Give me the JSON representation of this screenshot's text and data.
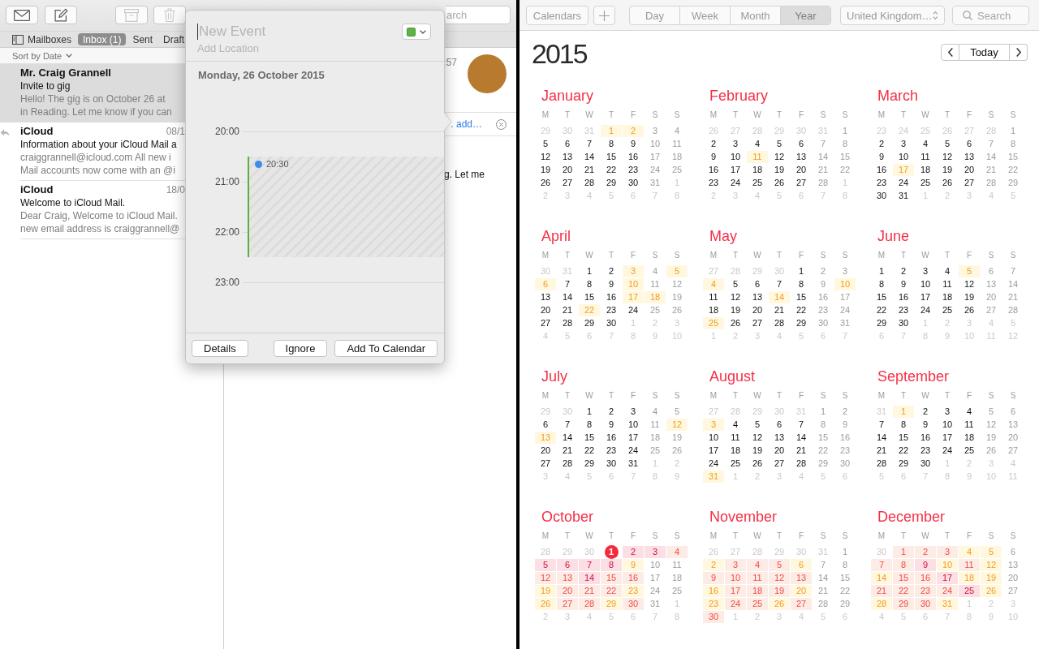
{
  "mail": {
    "toolbar": [
      {
        "kind": "get_mail",
        "disabled": false
      },
      {
        "kind": "compose",
        "disabled": false
      },
      {
        "kind": "archive",
        "disabled": true
      },
      {
        "kind": "trash",
        "disabled": true
      }
    ],
    "search": {
      "placeholder": "arch"
    },
    "favorites": [
      {
        "kind": "mailboxes",
        "label": "Mailboxes",
        "selected": false
      },
      {
        "kind": "mailbox",
        "label": "Inbox (1)",
        "selected": true
      },
      {
        "kind": "mailbox",
        "label": "Sent",
        "selected": false
      },
      {
        "kind": "mailbox",
        "label": "Draft",
        "selected": false
      }
    ],
    "sort": "Sort by Date",
    "messages": [
      {
        "sender": "Mr. Craig Grannell",
        "subject": "Invite to gig",
        "preview": [
          "Hello! The gig is on October 26 at",
          "in Reading. Let me know if you can"
        ],
        "selected": true,
        "replied": false
      },
      {
        "sender": "iCloud",
        "date": "08/1",
        "subject": "Information about your iCloud Mail a",
        "preview": [
          "craiggrannell@icloud.com All new i",
          "Mail accounts now come with an @i"
        ],
        "selected": false,
        "replied": true
      },
      {
        "sender": "iCloud",
        "date": "18/0",
        "subject": "Welcome to iCloud Mail.",
        "preview": [
          "Dear Craig, Welcome to iCloud Mail.",
          "new email address is craiggrannell@"
        ],
        "selected": false,
        "replied": false
      }
    ],
    "viewer": {
      "time": ":57",
      "banner_link": ". add…",
      "body": "g. Let me"
    }
  },
  "event_popover": {
    "title": {
      "placeholder": "New Event"
    },
    "location": {
      "placeholder": "Add Location"
    },
    "date": "Monday, 26 October 2015",
    "hours": [
      "20:00",
      "21:00",
      "22:00",
      "23:00"
    ],
    "event": {
      "start": "20:30"
    },
    "buttons": [
      "Details",
      "Ignore",
      "Add To Calendar"
    ]
  },
  "calendar": {
    "toolbar": {
      "calendars": "Calendars",
      "views": [
        {
          "label": "Day",
          "selected": false
        },
        {
          "label": "Week",
          "selected": false
        },
        {
          "label": "Month",
          "selected": false
        },
        {
          "label": "Year",
          "selected": true
        }
      ],
      "region": "United Kingdom…",
      "search": {
        "placeholder": "Search"
      }
    },
    "year": "2015",
    "today_button": "Today",
    "months": [
      {
        "name": "January",
        "weekdays": [
          "M",
          "T",
          "W",
          "T",
          "F",
          "S",
          "S"
        ],
        "lead": [
          "29",
          "30",
          "31"
        ],
        "days": [
          {
            "day": "1",
            "kind": "event"
          },
          {
            "day": "2",
            "kind": "event"
          },
          {
            "day": "3",
            "kind": "weekend"
          },
          {
            "day": "4",
            "kind": "weekend"
          },
          {
            "day": "5",
            "kind": "weekday"
          },
          {
            "day": "6",
            "kind": "weekday"
          },
          {
            "day": "7",
            "kind": "weekday"
          },
          {
            "day": "8",
            "kind": "weekday"
          },
          {
            "day": "9",
            "kind": "weekday"
          },
          {
            "day": "10",
            "kind": "weekend"
          },
          {
            "day": "11",
            "kind": "weekend"
          },
          {
            "day": "12",
            "kind": "weekday"
          },
          {
            "day": "13",
            "kind": "weekday"
          },
          {
            "day": "14",
            "kind": "weekday"
          },
          {
            "day": "15",
            "kind": "weekday"
          },
          {
            "day": "16",
            "kind": "weekday"
          },
          {
            "day": "17",
            "kind": "weekend"
          },
          {
            "day": "18",
            "kind": "weekend"
          },
          {
            "day": "19",
            "kind": "weekday"
          },
          {
            "day": "20",
            "kind": "weekday"
          },
          {
            "day": "21",
            "kind": "weekday"
          },
          {
            "day": "22",
            "kind": "weekday"
          },
          {
            "day": "23",
            "kind": "weekday"
          },
          {
            "day": "24",
            "kind": "weekend"
          },
          {
            "day": "25",
            "kind": "weekend"
          },
          {
            "day": "26",
            "kind": "weekday"
          },
          {
            "day": "27",
            "kind": "weekday"
          },
          {
            "day": "28",
            "kind": "weekday"
          },
          {
            "day": "29",
            "kind": "weekday"
          },
          {
            "day": "30",
            "kind": "weekday"
          },
          {
            "day": "31",
            "kind": "weekend"
          }
        ],
        "trail": [
          "1",
          "2",
          "3",
          "4",
          "5",
          "6",
          "7",
          "8"
        ]
      },
      {
        "name": "February",
        "weekdays": [
          "M",
          "T",
          "W",
          "T",
          "F",
          "S",
          "S"
        ],
        "lead": [
          "26",
          "27",
          "28",
          "29",
          "30",
          "31"
        ],
        "days": [
          {
            "day": "1",
            "kind": "weekend"
          },
          {
            "day": "2",
            "kind": "weekday"
          },
          {
            "day": "3",
            "kind": "weekday"
          },
          {
            "day": "4",
            "kind": "weekday"
          },
          {
            "day": "5",
            "kind": "weekday"
          },
          {
            "day": "6",
            "kind": "weekday"
          },
          {
            "day": "7",
            "kind": "weekend"
          },
          {
            "day": "8",
            "kind": "weekend"
          },
          {
            "day": "9",
            "kind": "weekday"
          },
          {
            "day": "10",
            "kind": "weekday"
          },
          {
            "day": "11",
            "kind": "event"
          },
          {
            "day": "12",
            "kind": "weekday"
          },
          {
            "day": "13",
            "kind": "weekday"
          },
          {
            "day": "14",
            "kind": "weekend"
          },
          {
            "day": "15",
            "kind": "weekend"
          },
          {
            "day": "16",
            "kind": "weekday"
          },
          {
            "day": "17",
            "kind": "weekday"
          },
          {
            "day": "18",
            "kind": "weekday"
          },
          {
            "day": "19",
            "kind": "weekday"
          },
          {
            "day": "20",
            "kind": "weekday"
          },
          {
            "day": "21",
            "kind": "weekend"
          },
          {
            "day": "22",
            "kind": "weekend"
          },
          {
            "day": "23",
            "kind": "weekday"
          },
          {
            "day": "24",
            "kind": "weekday"
          },
          {
            "day": "25",
            "kind": "weekday"
          },
          {
            "day": "26",
            "kind": "weekday"
          },
          {
            "day": "27",
            "kind": "weekday"
          },
          {
            "day": "28",
            "kind": "weekend"
          }
        ],
        "trail": [
          "1",
          "2",
          "3",
          "4",
          "5",
          "6",
          "7",
          "8"
        ]
      },
      {
        "name": "March",
        "weekdays": [
          "M",
          "T",
          "W",
          "T",
          "F",
          "S",
          "S"
        ],
        "lead": [
          "23",
          "24",
          "25",
          "26",
          "27",
          "28"
        ],
        "days": [
          {
            "day": "1",
            "kind": "weekend"
          },
          {
            "day": "2",
            "kind": "weekday"
          },
          {
            "day": "3",
            "kind": "weekday"
          },
          {
            "day": "4",
            "kind": "weekday"
          },
          {
            "day": "5",
            "kind": "weekday"
          },
          {
            "day": "6",
            "kind": "weekday"
          },
          {
            "day": "7",
            "kind": "weekend"
          },
          {
            "day": "8",
            "kind": "weekend"
          },
          {
            "day": "9",
            "kind": "weekday"
          },
          {
            "day": "10",
            "kind": "weekday"
          },
          {
            "day": "11",
            "kind": "weekday"
          },
          {
            "day": "12",
            "kind": "weekday"
          },
          {
            "day": "13",
            "kind": "weekday"
          },
          {
            "day": "14",
            "kind": "weekend"
          },
          {
            "day": "15",
            "kind": "weekend"
          },
          {
            "day": "16",
            "kind": "weekday"
          },
          {
            "day": "17",
            "kind": "event"
          },
          {
            "day": "18",
            "kind": "weekday"
          },
          {
            "day": "19",
            "kind": "weekday"
          },
          {
            "day": "20",
            "kind": "weekday"
          },
          {
            "day": "21",
            "kind": "weekend"
          },
          {
            "day": "22",
            "kind": "weekend"
          },
          {
            "day": "23",
            "kind": "weekday"
          },
          {
            "day": "24",
            "kind": "weekday"
          },
          {
            "day": "25",
            "kind": "weekday"
          },
          {
            "day": "26",
            "kind": "weekday"
          },
          {
            "day": "27",
            "kind": "weekday"
          },
          {
            "day": "28",
            "kind": "weekend"
          },
          {
            "day": "29",
            "kind": "weekend"
          },
          {
            "day": "30",
            "kind": "weekday"
          },
          {
            "day": "31",
            "kind": "weekday"
          }
        ],
        "trail": [
          "1",
          "2",
          "3",
          "4",
          "5"
        ]
      },
      {
        "name": "April",
        "weekdays": [
          "M",
          "T",
          "W",
          "T",
          "F",
          "S",
          "S"
        ],
        "lead": [
          "30",
          "31"
        ],
        "days": [
          {
            "day": "1",
            "kind": "weekday"
          },
          {
            "day": "2",
            "kind": "weekday"
          },
          {
            "day": "3",
            "kind": "event"
          },
          {
            "day": "4",
            "kind": "weekend"
          },
          {
            "day": "5",
            "kind": "event"
          },
          {
            "day": "6",
            "kind": "event"
          },
          {
            "day": "7",
            "kind": "weekday"
          },
          {
            "day": "8",
            "kind": "weekday"
          },
          {
            "day": "9",
            "kind": "weekday"
          },
          {
            "day": "10",
            "kind": "event"
          },
          {
            "day": "11",
            "kind": "weekend"
          },
          {
            "day": "12",
            "kind": "weekend"
          },
          {
            "day": "13",
            "kind": "weekday"
          },
          {
            "day": "14",
            "kind": "weekday"
          },
          {
            "day": "15",
            "kind": "weekday"
          },
          {
            "day": "16",
            "kind": "weekday"
          },
          {
            "day": "17",
            "kind": "event"
          },
          {
            "day": "18",
            "kind": "event"
          },
          {
            "day": "19",
            "kind": "weekend"
          },
          {
            "day": "20",
            "kind": "weekday"
          },
          {
            "day": "21",
            "kind": "weekday"
          },
          {
            "day": "22",
            "kind": "event"
          },
          {
            "day": "23",
            "kind": "weekday"
          },
          {
            "day": "24",
            "kind": "weekday"
          },
          {
            "day": "25",
            "kind": "weekend"
          },
          {
            "day": "26",
            "kind": "weekend"
          },
          {
            "day": "27",
            "kind": "weekday"
          },
          {
            "day": "28",
            "kind": "weekday"
          },
          {
            "day": "29",
            "kind": "weekday"
          },
          {
            "day": "30",
            "kind": "weekday"
          }
        ],
        "trail": [
          "1",
          "2",
          "3",
          "4",
          "5",
          "6",
          "7",
          "8",
          "9",
          "10"
        ]
      },
      {
        "name": "May",
        "weekdays": [
          "M",
          "T",
          "W",
          "T",
          "F",
          "S",
          "S"
        ],
        "lead": [
          "27",
          "28",
          "29",
          "30"
        ],
        "days": [
          {
            "day": "1",
            "kind": "weekday"
          },
          {
            "day": "2",
            "kind": "weekend"
          },
          {
            "day": "3",
            "kind": "weekend"
          },
          {
            "day": "4",
            "kind": "event"
          },
          {
            "day": "5",
            "kind": "weekday"
          },
          {
            "day": "6",
            "kind": "weekday"
          },
          {
            "day": "7",
            "kind": "weekday"
          },
          {
            "day": "8",
            "kind": "weekday"
          },
          {
            "day": "9",
            "kind": "weekend"
          },
          {
            "day": "10",
            "kind": "event"
          },
          {
            "day": "11",
            "kind": "weekday"
          },
          {
            "day": "12",
            "kind": "weekday"
          },
          {
            "day": "13",
            "kind": "weekday"
          },
          {
            "day": "14",
            "kind": "event"
          },
          {
            "day": "15",
            "kind": "weekday"
          },
          {
            "day": "16",
            "kind": "weekend"
          },
          {
            "day": "17",
            "kind": "weekend"
          },
          {
            "day": "18",
            "kind": "weekday"
          },
          {
            "day": "19",
            "kind": "weekday"
          },
          {
            "day": "20",
            "kind": "weekday"
          },
          {
            "day": "21",
            "kind": "weekday"
          },
          {
            "day": "22",
            "kind": "weekday"
          },
          {
            "day": "23",
            "kind": "weekend"
          },
          {
            "day": "24",
            "kind": "weekend"
          },
          {
            "day": "25",
            "kind": "event"
          },
          {
            "day": "26",
            "kind": "weekday"
          },
          {
            "day": "27",
            "kind": "weekday"
          },
          {
            "day": "28",
            "kind": "weekday"
          },
          {
            "day": "29",
            "kind": "weekday"
          },
          {
            "day": "30",
            "kind": "weekend"
          },
          {
            "day": "31",
            "kind": "weekend"
          }
        ],
        "trail": [
          "1",
          "2",
          "3",
          "4",
          "5",
          "6",
          "7"
        ]
      },
      {
        "name": "June",
        "weekdays": [
          "M",
          "T",
          "W",
          "T",
          "F",
          "S",
          "S"
        ],
        "days": [
          {
            "day": "1",
            "kind": "weekday"
          },
          {
            "day": "2",
            "kind": "weekday"
          },
          {
            "day": "3",
            "kind": "weekday"
          },
          {
            "day": "4",
            "kind": "weekday"
          },
          {
            "day": "5",
            "kind": "event"
          },
          {
            "day": "6",
            "kind": "weekend"
          },
          {
            "day": "7",
            "kind": "weekend"
          },
          {
            "day": "8",
            "kind": "weekday"
          },
          {
            "day": "9",
            "kind": "weekday"
          },
          {
            "day": "10",
            "kind": "weekday"
          },
          {
            "day": "11",
            "kind": "weekday"
          },
          {
            "day": "12",
            "kind": "weekday"
          },
          {
            "day": "13",
            "kind": "weekend"
          },
          {
            "day": "14",
            "kind": "weekend"
          },
          {
            "day": "15",
            "kind": "weekday"
          },
          {
            "day": "16",
            "kind": "weekday"
          },
          {
            "day": "17",
            "kind": "weekday"
          },
          {
            "day": "18",
            "kind": "weekday"
          },
          {
            "day": "19",
            "kind": "weekday"
          },
          {
            "day": "20",
            "kind": "weekend"
          },
          {
            "day": "21",
            "kind": "weekend"
          },
          {
            "day": "22",
            "kind": "weekday"
          },
          {
            "day": "23",
            "kind": "weekday"
          },
          {
            "day": "24",
            "kind": "weekday"
          },
          {
            "day": "25",
            "kind": "weekday"
          },
          {
            "day": "26",
            "kind": "weekday"
          },
          {
            "day": "27",
            "kind": "weekend"
          },
          {
            "day": "28",
            "kind": "weekend"
          },
          {
            "day": "29",
            "kind": "weekday"
          },
          {
            "day": "30",
            "kind": "weekday"
          }
        ],
        "trail": [
          "1",
          "2",
          "3",
          "4",
          "5",
          "6",
          "7",
          "8",
          "9",
          "10",
          "11",
          "12"
        ]
      },
      {
        "name": "July",
        "weekdays": [
          "M",
          "T",
          "W",
          "T",
          "F",
          "S",
          "S"
        ],
        "lead": [
          "29",
          "30"
        ],
        "days": [
          {
            "day": "1",
            "kind": "weekday"
          },
          {
            "day": "2",
            "kind": "weekday"
          },
          {
            "day": "3",
            "kind": "weekday"
          },
          {
            "day": "4",
            "kind": "weekend"
          },
          {
            "day": "5",
            "kind": "weekend"
          },
          {
            "day": "6",
            "kind": "weekday"
          },
          {
            "day": "7",
            "kind": "weekday"
          },
          {
            "day": "8",
            "kind": "weekday"
          },
          {
            "day": "9",
            "kind": "weekday"
          },
          {
            "day": "10",
            "kind": "weekday"
          },
          {
            "day": "11",
            "kind": "weekend"
          },
          {
            "day": "12",
            "kind": "event"
          },
          {
            "day": "13",
            "kind": "event"
          },
          {
            "day": "14",
            "kind": "weekday"
          },
          {
            "day": "15",
            "kind": "weekday"
          },
          {
            "day": "16",
            "kind": "weekday"
          },
          {
            "day": "17",
            "kind": "weekday"
          },
          {
            "day": "18",
            "kind": "weekend"
          },
          {
            "day": "19",
            "kind": "weekend"
          },
          {
            "day": "20",
            "kind": "weekday"
          },
          {
            "day": "21",
            "kind": "weekday"
          },
          {
            "day": "22",
            "kind": "weekday"
          },
          {
            "day": "23",
            "kind": "weekday"
          },
          {
            "day": "24",
            "kind": "weekday"
          },
          {
            "day": "25",
            "kind": "weekend"
          },
          {
            "day": "26",
            "kind": "weekend"
          },
          {
            "day": "27",
            "kind": "weekday"
          },
          {
            "day": "28",
            "kind": "weekday"
          },
          {
            "day": "29",
            "kind": "weekday"
          },
          {
            "day": "30",
            "kind": "weekday"
          },
          {
            "day": "31",
            "kind": "weekday"
          }
        ],
        "trail": [
          "1",
          "2",
          "3",
          "4",
          "5",
          "6",
          "7",
          "8",
          "9"
        ]
      },
      {
        "name": "August",
        "weekdays": [
          "M",
          "T",
          "W",
          "T",
          "F",
          "S",
          "S"
        ],
        "lead": [
          "27",
          "28",
          "29",
          "30",
          "31"
        ],
        "days": [
          {
            "day": "1",
            "kind": "weekend"
          },
          {
            "day": "2",
            "kind": "weekend"
          },
          {
            "day": "3",
            "kind": "event"
          },
          {
            "day": "4",
            "kind": "weekday"
          },
          {
            "day": "5",
            "kind": "weekday"
          },
          {
            "day": "6",
            "kind": "weekday"
          },
          {
            "day": "7",
            "kind": "weekday"
          },
          {
            "day": "8",
            "kind": "weekend"
          },
          {
            "day": "9",
            "kind": "weekend"
          },
          {
            "day": "10",
            "kind": "weekday"
          },
          {
            "day": "11",
            "kind": "weekday"
          },
          {
            "day": "12",
            "kind": "weekday"
          },
          {
            "day": "13",
            "kind": "weekday"
          },
          {
            "day": "14",
            "kind": "weekday"
          },
          {
            "day": "15",
            "kind": "weekend"
          },
          {
            "day": "16",
            "kind": "weekend"
          },
          {
            "day": "17",
            "kind": "weekday"
          },
          {
            "day": "18",
            "kind": "weekday"
          },
          {
            "day": "19",
            "kind": "weekday"
          },
          {
            "day": "20",
            "kind": "weekday"
          },
          {
            "day": "21",
            "kind": "weekday"
          },
          {
            "day": "22",
            "kind": "weekend"
          },
          {
            "day": "23",
            "kind": "weekend"
          },
          {
            "day": "24",
            "kind": "weekday"
          },
          {
            "day": "25",
            "kind": "weekday"
          },
          {
            "day": "26",
            "kind": "weekday"
          },
          {
            "day": "27",
            "kind": "weekday"
          },
          {
            "day": "28",
            "kind": "weekday"
          },
          {
            "day": "29",
            "kind": "weekend"
          },
          {
            "day": "30",
            "kind": "weekend"
          },
          {
            "day": "31",
            "kind": "event"
          }
        ],
        "trail": [
          "1",
          "2",
          "3",
          "4",
          "5",
          "6"
        ]
      },
      {
        "name": "September",
        "weekdays": [
          "M",
          "T",
          "W",
          "T",
          "F",
          "S",
          "S"
        ],
        "lead": [
          "31"
        ],
        "days": [
          {
            "day": "1",
            "kind": "event"
          },
          {
            "day": "2",
            "kind": "weekday"
          },
          {
            "day": "3",
            "kind": "weekday"
          },
          {
            "day": "4",
            "kind": "weekday"
          },
          {
            "day": "5",
            "kind": "weekend"
          },
          {
            "day": "6",
            "kind": "weekend"
          },
          {
            "day": "7",
            "kind": "weekday"
          },
          {
            "day": "8",
            "kind": "weekday"
          },
          {
            "day": "9",
            "kind": "weekday"
          },
          {
            "day": "10",
            "kind": "weekday"
          },
          {
            "day": "11",
            "kind": "weekday"
          },
          {
            "day": "12",
            "kind": "weekend"
          },
          {
            "day": "13",
            "kind": "weekend"
          },
          {
            "day": "14",
            "kind": "weekday"
          },
          {
            "day": "15",
            "kind": "weekday"
          },
          {
            "day": "16",
            "kind": "weekday"
          },
          {
            "day": "17",
            "kind": "weekday"
          },
          {
            "day": "18",
            "kind": "weekday"
          },
          {
            "day": "19",
            "kind": "weekend"
          },
          {
            "day": "20",
            "kind": "weekend"
          },
          {
            "day": "21",
            "kind": "weekday"
          },
          {
            "day": "22",
            "kind": "weekday"
          },
          {
            "day": "23",
            "kind": "weekday"
          },
          {
            "day": "24",
            "kind": "weekday"
          },
          {
            "day": "25",
            "kind": "weekday"
          },
          {
            "day": "26",
            "kind": "weekend"
          },
          {
            "day": "27",
            "kind": "weekend"
          },
          {
            "day": "28",
            "kind": "weekday"
          },
          {
            "day": "29",
            "kind": "weekday"
          },
          {
            "day": "30",
            "kind": "weekday"
          }
        ],
        "trail": [
          "1",
          "2",
          "3",
          "4",
          "5",
          "6",
          "7",
          "8",
          "9",
          "10",
          "11"
        ]
      },
      {
        "name": "October",
        "weekdays": [
          "M",
          "T",
          "W",
          "T",
          "F",
          "S",
          "S"
        ],
        "lead": [
          "28",
          "29",
          "30"
        ],
        "days": [
          {
            "day": "1",
            "kind": "today"
          },
          {
            "day": "2",
            "kind": "packed"
          },
          {
            "day": "3",
            "kind": "packed"
          },
          {
            "day": "4",
            "kind": "busy"
          },
          {
            "day": "5",
            "kind": "packed"
          },
          {
            "day": "6",
            "kind": "packed"
          },
          {
            "day": "7",
            "kind": "packed"
          },
          {
            "day": "8",
            "kind": "packed"
          },
          {
            "day": "9",
            "kind": "event"
          },
          {
            "day": "10",
            "kind": "weekend"
          },
          {
            "day": "11",
            "kind": "weekend"
          },
          {
            "day": "12",
            "kind": "busy"
          },
          {
            "day": "13",
            "kind": "busy"
          },
          {
            "day": "14",
            "kind": "packed"
          },
          {
            "day": "15",
            "kind": "busy"
          },
          {
            "day": "16",
            "kind": "busy"
          },
          {
            "day": "17",
            "kind": "weekend"
          },
          {
            "day": "18",
            "kind": "weekend"
          },
          {
            "day": "19",
            "kind": "event"
          },
          {
            "day": "20",
            "kind": "busy"
          },
          {
            "day": "21",
            "kind": "busy"
          },
          {
            "day": "22",
            "kind": "busy"
          },
          {
            "day": "23",
            "kind": "event"
          },
          {
            "day": "24",
            "kind": "weekend"
          },
          {
            "day": "25",
            "kind": "weekend"
          },
          {
            "day": "26",
            "kind": "event"
          },
          {
            "day": "27",
            "kind": "busy"
          },
          {
            "day": "28",
            "kind": "busy"
          },
          {
            "day": "29",
            "kind": "event"
          },
          {
            "day": "30",
            "kind": "busy"
          },
          {
            "day": "31",
            "kind": "weekend"
          }
        ],
        "trail": [
          "1",
          "2",
          "3",
          "4",
          "5",
          "6",
          "7",
          "8"
        ]
      },
      {
        "name": "November",
        "weekdays": [
          "M",
          "T",
          "W",
          "T",
          "F",
          "S",
          "S"
        ],
        "lead": [
          "26",
          "27",
          "28",
          "29",
          "30",
          "31"
        ],
        "days": [
          {
            "day": "1",
            "kind": "weekend"
          },
          {
            "day": "2",
            "kind": "event"
          },
          {
            "day": "3",
            "kind": "busy"
          },
          {
            "day": "4",
            "kind": "busy"
          },
          {
            "day": "5",
            "kind": "busy"
          },
          {
            "day": "6",
            "kind": "event"
          },
          {
            "day": "7",
            "kind": "weekend"
          },
          {
            "day": "8",
            "kind": "weekend"
          },
          {
            "day": "9",
            "kind": "busy"
          },
          {
            "day": "10",
            "kind": "busy"
          },
          {
            "day": "11",
            "kind": "busy"
          },
          {
            "day": "12",
            "kind": "busy"
          },
          {
            "day": "13",
            "kind": "busy"
          },
          {
            "day": "14",
            "kind": "weekend"
          },
          {
            "day": "15",
            "kind": "weekend"
          },
          {
            "day": "16",
            "kind": "event"
          },
          {
            "day": "17",
            "kind": "busy"
          },
          {
            "day": "18",
            "kind": "busy"
          },
          {
            "day": "19",
            "kind": "busy"
          },
          {
            "day": "20",
            "kind": "event"
          },
          {
            "day": "21",
            "kind": "weekend"
          },
          {
            "day": "22",
            "kind": "weekend"
          },
          {
            "day": "23",
            "kind": "event"
          },
          {
            "day": "24",
            "kind": "busy"
          },
          {
            "day": "25",
            "kind": "busy"
          },
          {
            "day": "26",
            "kind": "event"
          },
          {
            "day": "27",
            "kind": "busy"
          },
          {
            "day": "28",
            "kind": "weekend"
          },
          {
            "day": "29",
            "kind": "weekend"
          },
          {
            "day": "30",
            "kind": "busy"
          }
        ],
        "trail": [
          "1",
          "2",
          "3",
          "4",
          "5",
          "6"
        ]
      },
      {
        "name": "December",
        "weekdays": [
          "M",
          "T",
          "W",
          "T",
          "F",
          "S",
          "S"
        ],
        "lead": [
          "30"
        ],
        "days": [
          {
            "day": "1",
            "kind": "busy"
          },
          {
            "day": "2",
            "kind": "busy"
          },
          {
            "day": "3",
            "kind": "busy"
          },
          {
            "day": "4",
            "kind": "event"
          },
          {
            "day": "5",
            "kind": "event"
          },
          {
            "day": "6",
            "kind": "weekend"
          },
          {
            "day": "7",
            "kind": "busy"
          },
          {
            "day": "8",
            "kind": "busy"
          },
          {
            "day": "9",
            "kind": "packed"
          },
          {
            "day": "10",
            "kind": "event"
          },
          {
            "day": "11",
            "kind": "busy"
          },
          {
            "day": "12",
            "kind": "event"
          },
          {
            "day": "13",
            "kind": "weekend"
          },
          {
            "day": "14",
            "kind": "event"
          },
          {
            "day": "15",
            "kind": "busy"
          },
          {
            "day": "16",
            "kind": "busy"
          },
          {
            "day": "17",
            "kind": "packed"
          },
          {
            "day": "18",
            "kind": "event"
          },
          {
            "day": "19",
            "kind": "event"
          },
          {
            "day": "20",
            "kind": "weekend"
          },
          {
            "day": "21",
            "kind": "busy"
          },
          {
            "day": "22",
            "kind": "busy"
          },
          {
            "day": "23",
            "kind": "busy"
          },
          {
            "day": "24",
            "kind": "busy"
          },
          {
            "day": "25",
            "kind": "packed"
          },
          {
            "day": "26",
            "kind": "event"
          },
          {
            "day": "27",
            "kind": "weekend"
          },
          {
            "day": "28",
            "kind": "event"
          },
          {
            "day": "29",
            "kind": "busy"
          },
          {
            "day": "30",
            "kind": "busy"
          },
          {
            "day": "31",
            "kind": "event"
          }
        ],
        "trail": [
          "1",
          "2",
          "3",
          "4",
          "5",
          "6",
          "7",
          "8",
          "9",
          "10"
        ]
      }
    ]
  }
}
